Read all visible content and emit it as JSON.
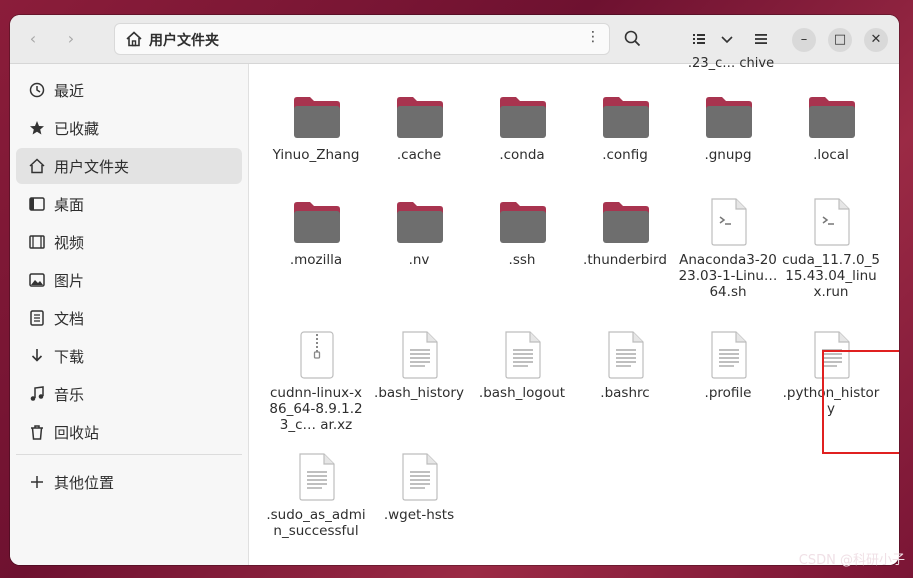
{
  "header": {
    "back_icon": "chevron-left-icon",
    "forward_icon": "chevron-right-icon",
    "path_label": "用户文件夹",
    "path_icon": "home-icon",
    "menu_icon": "more-vertical-icon",
    "search_icon": "search-icon",
    "view_icon": "list-view-icon",
    "sort_icon": "chevron-down-icon",
    "hamburger_icon": "hamburger-menu-icon",
    "minimize_icon": "minimize-icon",
    "maximize_icon": "maximize-icon",
    "close_icon": "close-icon"
  },
  "sidebar": {
    "items": [
      {
        "label": "最近",
        "icon": "clock-icon"
      },
      {
        "label": "已收藏",
        "icon": "star-icon"
      },
      {
        "label": "用户文件夹",
        "icon": "home-icon",
        "active": true
      },
      {
        "label": "桌面",
        "icon": "desktop-icon"
      },
      {
        "label": "视频",
        "icon": "video-icon"
      },
      {
        "label": "图片",
        "icon": "picture-icon"
      },
      {
        "label": "文档",
        "icon": "document-icon"
      },
      {
        "label": "下载",
        "icon": "download-icon"
      },
      {
        "label": "音乐",
        "icon": "music-icon"
      },
      {
        "label": "回收站",
        "icon": "trash-icon"
      }
    ],
    "other": {
      "label": "其他位置",
      "icon": "plus-icon"
    }
  },
  "files": {
    "top_cut_label": ".23_c… chive",
    "items": [
      {
        "name": "Yinuo_Zhang",
        "type": "folder"
      },
      {
        "name": ".cache",
        "type": "folder"
      },
      {
        "name": ".conda",
        "type": "folder"
      },
      {
        "name": ".config",
        "type": "folder"
      },
      {
        "name": ".gnupg",
        "type": "folder"
      },
      {
        "name": ".local",
        "type": "folder"
      },
      {
        "name": ".mozilla",
        "type": "folder"
      },
      {
        "name": ".nv",
        "type": "folder"
      },
      {
        "name": ".ssh",
        "type": "folder"
      },
      {
        "name": ".thunderbird",
        "type": "folder"
      },
      {
        "name": "Anaconda3-2023.03-1-Linu… 64.sh",
        "type": "script"
      },
      {
        "name": "cuda_11.7.0_515.43.04_linux.run",
        "type": "script"
      },
      {
        "name": "cudnn-linux-x86_64-8.9.1.23_c… ar.xz",
        "type": "archive"
      },
      {
        "name": ".bash_history",
        "type": "text"
      },
      {
        "name": ".bash_logout",
        "type": "text"
      },
      {
        "name": ".bashrc",
        "type": "text",
        "highlighted": true
      },
      {
        "name": ".profile",
        "type": "text"
      },
      {
        "name": ".python_history",
        "type": "text"
      },
      {
        "name": ".sudo_as_admin_successful",
        "type": "text"
      },
      {
        "name": ".wget-hsts",
        "type": "text"
      }
    ]
  },
  "watermark": "CSDN @科研小子",
  "colors": {
    "folder_tab": "#a8344f",
    "folder_body": "#6e6e6e",
    "highlight": "#e02020",
    "accent": "#e95420"
  }
}
